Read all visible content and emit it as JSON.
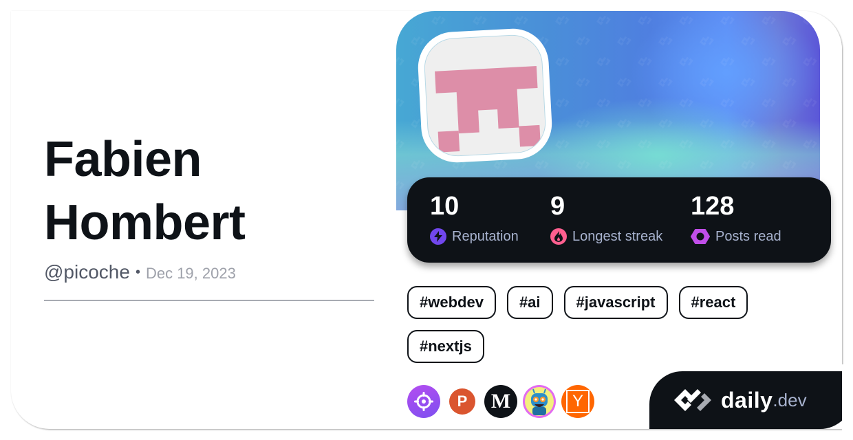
{
  "profile": {
    "name": "Fabien Hombert",
    "name_line1": "Fabien",
    "name_line2": "Hombert",
    "handle": "@picoche",
    "separator": "•",
    "joined_date": "Dec 19, 2023"
  },
  "stats": [
    {
      "value": "10",
      "label": "Reputation",
      "icon": "lightning-icon",
      "color": "#7147ed"
    },
    {
      "value": "9",
      "label": "Longest streak",
      "icon": "flame-icon",
      "color": "#ff5f8f"
    },
    {
      "value": "128",
      "label": "Posts read",
      "icon": "eye-icon",
      "color": "#c04ee8"
    }
  ],
  "tags": [
    "#webdev",
    "#ai",
    "#javascript",
    "#react",
    "#nextjs"
  ],
  "sources": [
    {
      "name": "crosshair-source",
      "label": "",
      "color": "#9c4eef"
    },
    {
      "name": "product-hunt-source",
      "label": "P",
      "color": "#da552f"
    },
    {
      "name": "medium-source",
      "label": "M",
      "color": "#0e1217"
    },
    {
      "name": "robot-source",
      "label": "",
      "color": "#e26bf0"
    },
    {
      "name": "hacker-news-source",
      "label": "Y",
      "color": "#ff6600"
    }
  ],
  "brand": {
    "word": "daily",
    "tld": ".dev"
  },
  "colors": {
    "text_primary": "#0e1217",
    "stats_bg": "#0e1217",
    "avatar_pink": "#dd8ea8"
  }
}
